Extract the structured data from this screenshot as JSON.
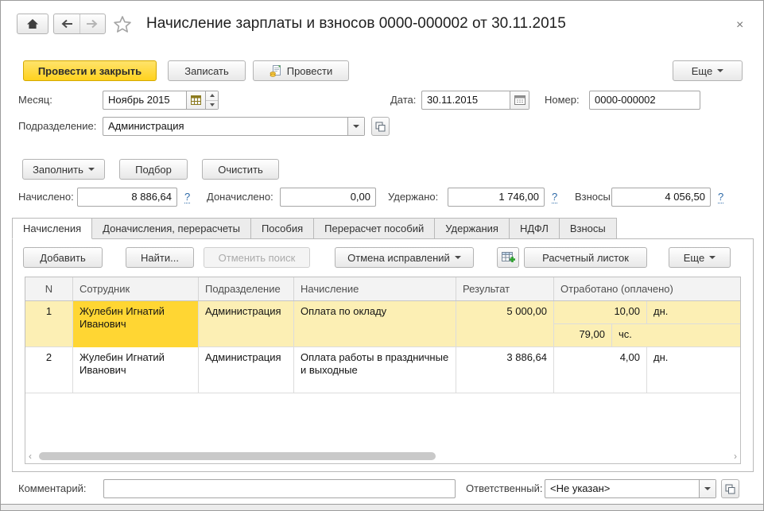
{
  "window": {
    "title": "Начисление зарплаты и взносов 0000-000002 от 30.11.2015",
    "close_glyph": "×"
  },
  "command_bar": {
    "post_and_close": "Провести и закрыть",
    "write": "Записать",
    "post": "Провести",
    "more": "Еще"
  },
  "fields": {
    "month": {
      "label": "Месяц:",
      "value": "Ноябрь 2015"
    },
    "date": {
      "label": "Дата:",
      "value": "30.11.2015"
    },
    "number": {
      "label": "Номер:",
      "value": "0000-000002"
    },
    "department": {
      "label": "Подразделение:",
      "value": "Администрация"
    }
  },
  "fill_actions": {
    "fill": "Заполнить",
    "pick": "Подбор",
    "clear": "Очистить"
  },
  "totals": {
    "accrued": {
      "label": "Начислено:",
      "value": "8 886,64",
      "help": "?"
    },
    "additional": {
      "label": "Доначислено:",
      "value": "0,00"
    },
    "withheld": {
      "label": "Удержано:",
      "value": "1 746,00",
      "help": "?"
    },
    "contributions": {
      "label": "Взносы:",
      "value": "4 056,50",
      "help": "?"
    }
  },
  "tabs": [
    {
      "label": "Начисления",
      "active": true
    },
    {
      "label": "Доначисления, перерасчеты",
      "active": false
    },
    {
      "label": "Пособия",
      "active": false
    },
    {
      "label": "Перерасчет пособий",
      "active": false
    },
    {
      "label": "Удержания",
      "active": false
    },
    {
      "label": "НДФЛ",
      "active": false
    },
    {
      "label": "Взносы",
      "active": false
    }
  ],
  "grid_toolbar": {
    "add": "Добавить",
    "find": "Найти...",
    "cancel_search": "Отменить поиск",
    "undo_corrections": "Отмена исправлений",
    "payslip": "Расчетный листок",
    "more": "Еще"
  },
  "grid": {
    "columns": [
      "N",
      "Сотрудник",
      "Подразделение",
      "Начисление",
      "Результат",
      "Отработано (оплачено)"
    ],
    "rows": [
      {
        "n": "1",
        "employee": "Жулебин Игнатий Иванович",
        "department": "Администрация",
        "accrual": "Оплата по окладу",
        "result": "5 000,00",
        "worked": [
          {
            "value": "10,00",
            "unit": "дн."
          },
          {
            "value": "79,00",
            "unit": "чс."
          }
        ]
      },
      {
        "n": "2",
        "employee": "Жулебин Игнатий Иванович",
        "department": "Администрация",
        "accrual": "Оплата работы в праздничные и выходные",
        "result": "3 886,64",
        "worked": [
          {
            "value": "4,00",
            "unit": "дн."
          }
        ]
      }
    ]
  },
  "footer": {
    "comment_label": "Комментарий:",
    "comment_value": "",
    "responsible_label": "Ответственный:",
    "responsible_value": "<Не указан>"
  },
  "colors": {
    "primary_button": "#FFD633",
    "row_selection": "#FCEFB4",
    "current_cell": "#FFD633",
    "help_link": "#2F6BA8"
  }
}
